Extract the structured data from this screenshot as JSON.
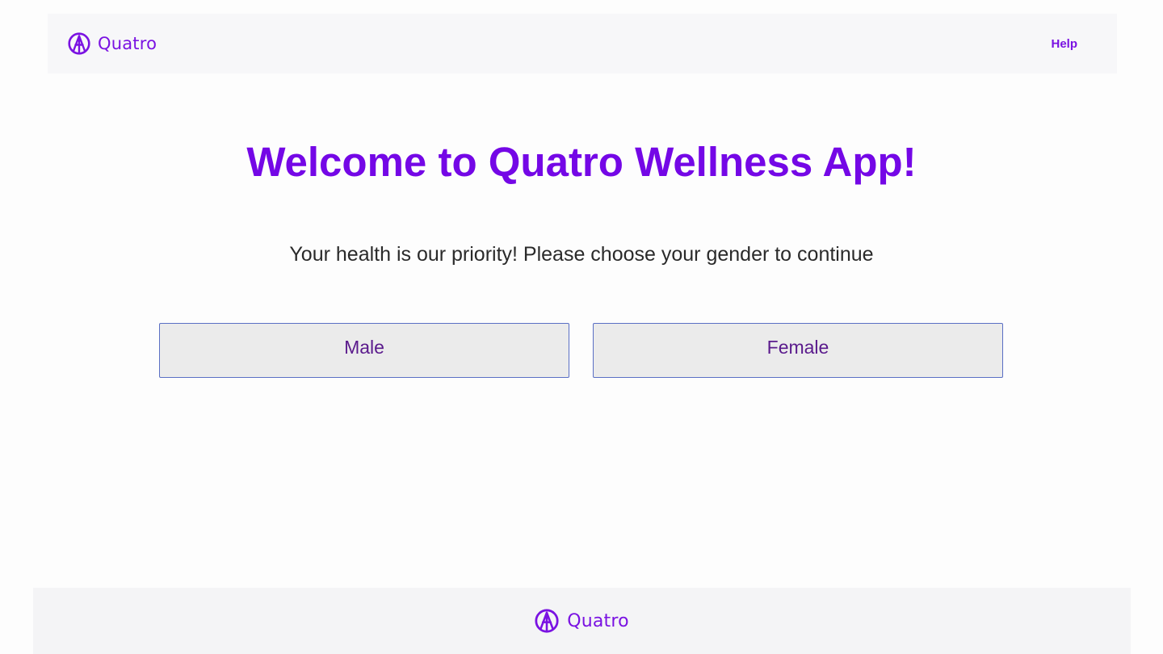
{
  "header": {
    "brand_name": "Quatro",
    "logo_icon": "quatro-logo-icon",
    "help_label": "Help"
  },
  "main": {
    "title": "Welcome to Quatro Wellness App!",
    "subtitle": "Your health is our priority! Please choose your gender to continue",
    "options": [
      {
        "label": "Male"
      },
      {
        "label": "Female"
      }
    ]
  },
  "footer": {
    "brand_name": "Quatro",
    "logo_icon": "quatro-logo-icon"
  },
  "colors": {
    "accent": "#7407e6",
    "button_bg": "#ebebeb",
    "button_border": "#5a6fc4",
    "button_text": "#5a1a8c",
    "header_bg": "#f7f7f9",
    "footer_bg": "#f4f4f6"
  }
}
